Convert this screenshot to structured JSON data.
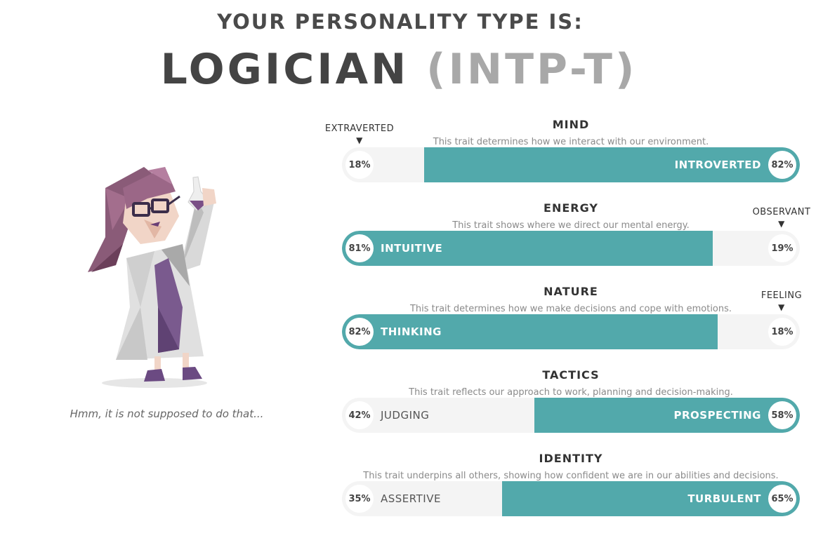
{
  "header": {
    "subtitle": "YOUR PERSONALITY TYPE IS:",
    "type_name": "LOGICIAN",
    "type_code": "(INTP-T)"
  },
  "avatar": {
    "caption": "Hmm, it is not supposed to do that..."
  },
  "colors": {
    "accent": "#52a9ab",
    "bar_background": "#f4f4f4"
  },
  "traits": [
    {
      "name": "MIND",
      "description": "This trait determines how we interact with our environment.",
      "marker": "EXTRAVERTED",
      "left_label": "",
      "left_percent": "18%",
      "right_label": "INTROVERTED",
      "right_percent": "82%",
      "dominant": "right",
      "dominant_value": 0.82
    },
    {
      "name": "ENERGY",
      "description": "This trait shows where we direct our mental energy.",
      "marker": "OBSERVANT",
      "left_label": "INTUITIVE",
      "left_percent": "81%",
      "right_label": "",
      "right_percent": "19%",
      "dominant": "left",
      "dominant_value": 0.81
    },
    {
      "name": "NATURE",
      "description": "This trait determines how we make decisions and cope with emotions.",
      "marker": "FEELING",
      "left_label": "THINKING",
      "left_percent": "82%",
      "right_label": "",
      "right_percent": "18%",
      "dominant": "left",
      "dominant_value": 0.82
    },
    {
      "name": "TACTICS",
      "description": "This trait reflects our approach to work, planning and decision-making.",
      "marker": "",
      "left_label": "JUDGING",
      "left_percent": "42%",
      "right_label": "PROSPECTING",
      "right_percent": "58%",
      "dominant": "right",
      "dominant_value": 0.58
    },
    {
      "name": "IDENTITY",
      "description": "This trait underpins all others, showing how confident we are in our abilities and decisions.",
      "marker": "",
      "left_label": "ASSERTIVE",
      "left_percent": "35%",
      "right_label": "TURBULENT",
      "right_percent": "65%",
      "dominant": "right",
      "dominant_value": 0.65
    }
  ]
}
